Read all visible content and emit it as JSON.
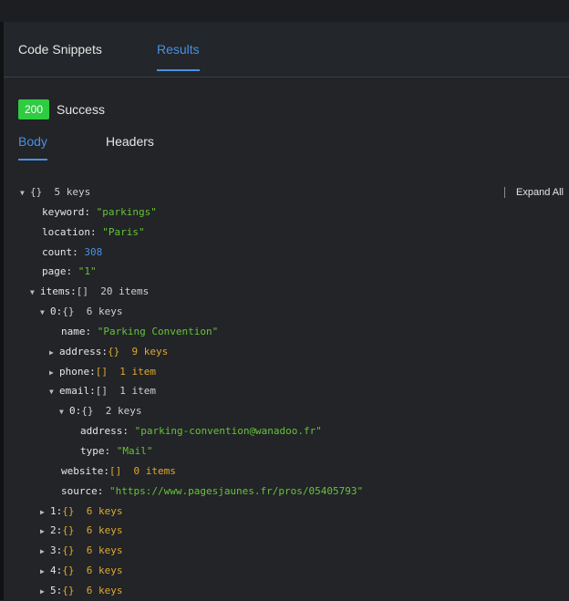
{
  "tabs": {
    "code_snippets": "Code Snippets",
    "results": "Results"
  },
  "status": {
    "code": "200",
    "text": "Success"
  },
  "subtabs": {
    "body": "Body",
    "headers": "Headers"
  },
  "expand_all": "Expand All",
  "tree": {
    "root": {
      "brace": "{}",
      "count": "5 keys"
    },
    "keyword": {
      "key": "keyword:",
      "value": "\"parkings\""
    },
    "location": {
      "key": "location:",
      "value": "\"Paris\""
    },
    "count": {
      "key": "count:",
      "value": "308"
    },
    "page": {
      "key": "page:",
      "value": "\"1\""
    },
    "items": {
      "key": "items:",
      "brace": "[]",
      "count": "20 items"
    },
    "item0": {
      "key": "0:",
      "brace": "{}",
      "count": "6 keys"
    },
    "name": {
      "key": "name:",
      "value": "\"Parking Convention\""
    },
    "address": {
      "key": "address:",
      "brace": "{}",
      "count": "9 keys"
    },
    "phone": {
      "key": "phone:",
      "brace": "[]",
      "count": "1 item"
    },
    "email": {
      "key": "email:",
      "brace": "[]",
      "count": "1 item"
    },
    "email0": {
      "key": "0:",
      "brace": "{}",
      "count": "2 keys"
    },
    "email_address": {
      "key": "address:",
      "value": "\"parking-convention@wanadoo.fr\""
    },
    "email_type": {
      "key": "type:",
      "value": "\"Mail\""
    },
    "website": {
      "key": "website:",
      "brace": "[]",
      "count": "0 items"
    },
    "source": {
      "key": "source:",
      "value": "\"https://www.pagesjaunes.fr/pros/05405793\""
    },
    "item1": {
      "key": "1:",
      "brace": "{}",
      "count": "6 keys"
    },
    "item2": {
      "key": "2:",
      "brace": "{}",
      "count": "6 keys"
    },
    "item3": {
      "key": "3:",
      "brace": "{}",
      "count": "6 keys"
    },
    "item4": {
      "key": "4:",
      "brace": "{}",
      "count": "6 keys"
    },
    "item5": {
      "key": "5:",
      "brace": "{}",
      "count": "6 keys"
    }
  }
}
